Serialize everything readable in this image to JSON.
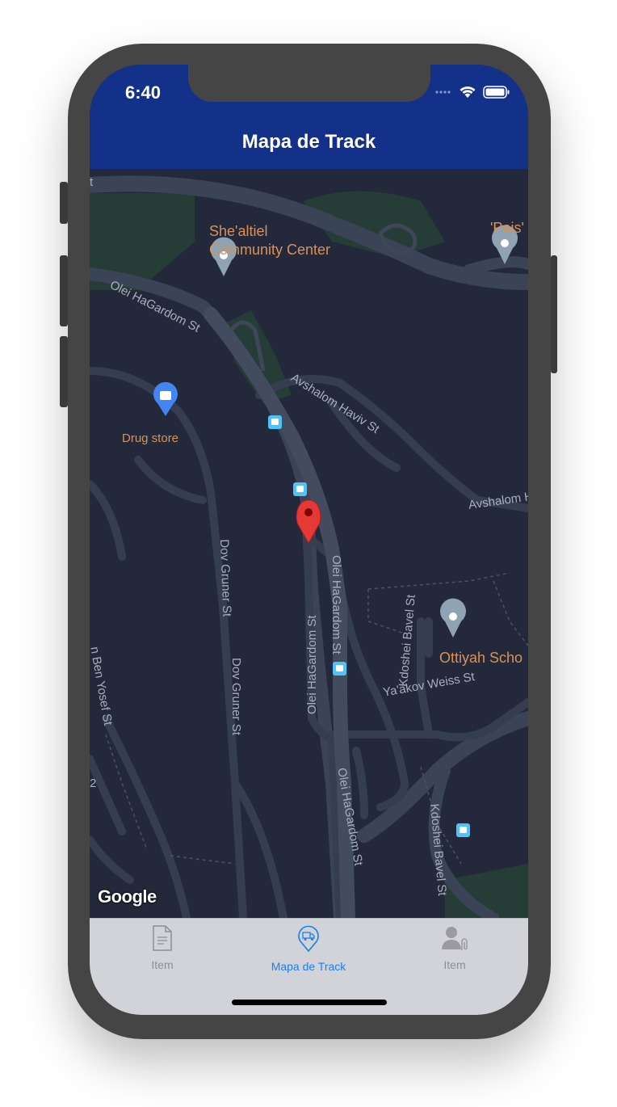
{
  "status_bar": {
    "time": "6:40"
  },
  "nav": {
    "title": "Mapa de Track"
  },
  "map": {
    "pois": {
      "community_center": "She'altiel\nCommunity Center",
      "pais": "'Pais'",
      "drug_store": "Drug store",
      "school": "Ottiyah Scho"
    },
    "streets": {
      "olei_hagardom_top": "Olei HaGardom St",
      "avshalom_haviv": "Avshalom Haviv St",
      "avshalom_right": "Avshalom H",
      "dov_gruner_1": "Dov Gruner St",
      "dov_gruner_2": "Dov Gruner St",
      "olei_hagardom_mid_left": "Olei HaGardom St",
      "olei_hagardom_mid_right": "Olei HaGardom St",
      "olei_hagardom_bottom": "Olei HaGardom St",
      "kdoshei_bavel_1": "Kdoshei Bavel St",
      "kdoshei_bavel_2": "Kdoshei Bavel St",
      "yaakov_weiss": "Ya'akov Weiss St",
      "ben_yosef": "n Ben Yosef St",
      "edge_t": "t",
      "edge_2": "2"
    },
    "attribution": "Google"
  },
  "tabbar": {
    "tabs": [
      {
        "label": "Item",
        "icon": "document-icon",
        "active": false
      },
      {
        "label": "Mapa de Track",
        "icon": "truck-pin-icon",
        "active": true
      },
      {
        "label": "Item",
        "icon": "person-clip-icon",
        "active": false
      }
    ]
  },
  "colors": {
    "nav": "#14318a",
    "map_bg": "#23293a",
    "accent": "#1a7ef2",
    "pin": "#e53935"
  }
}
